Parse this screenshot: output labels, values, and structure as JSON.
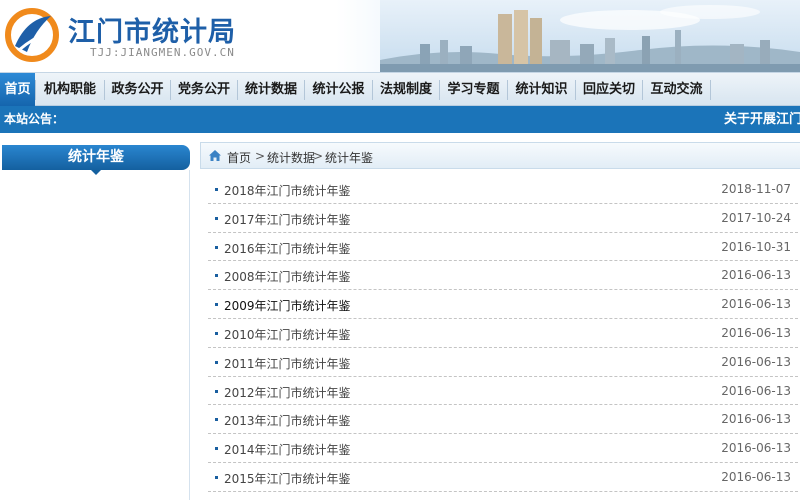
{
  "header": {
    "site_name": "江门市统计局",
    "domain": "TJJ:JIANGMEN.GOV.CN"
  },
  "nav": {
    "items": [
      "首页",
      "机构职能",
      "政务公开",
      "党务公开",
      "统计数据",
      "统计公报",
      "法规制度",
      "学习专题",
      "统计知识",
      "回应关切",
      "互动交流"
    ],
    "active_index": 0
  },
  "notice": {
    "label": "本站公告：",
    "text": "关于开展江门"
  },
  "sidebar": {
    "title": "统计年鉴"
  },
  "breadcrumb": [
    "首页",
    "统计数据",
    "统计年鉴"
  ],
  "breadcrumb_separator": ">",
  "list": [
    {
      "title": "2018年江门市统计年鉴",
      "date": "2018-11-07"
    },
    {
      "title": "2017年江门市统计年鉴",
      "date": "2017-10-24"
    },
    {
      "title": "2016年江门市统计年鉴",
      "date": "2016-10-31"
    },
    {
      "title": "2008年江门市统计年鉴",
      "date": "2016-06-13"
    },
    {
      "title": "2009年江门市统计年鉴",
      "date": "2016-06-13"
    },
    {
      "title": "2010年江门市统计年鉴",
      "date": "2016-06-13"
    },
    {
      "title": "2011年江门市统计年鉴",
      "date": "2016-06-13"
    },
    {
      "title": "2012年江门市统计年鉴",
      "date": "2016-06-13"
    },
    {
      "title": "2013年江门市统计年鉴",
      "date": "2016-06-13"
    },
    {
      "title": "2014年江门市统计年鉴",
      "date": "2016-06-13"
    },
    {
      "title": "2015年江门市统计年鉴",
      "date": "2016-06-13"
    }
  ],
  "colors": {
    "brand_blue": "#1e5fa8",
    "nav_active": "#1565ad",
    "notice_bar": "#1b74b9",
    "logo_orange": "#f08a1c"
  },
  "icons": {
    "logo": "jiangmen-stats-logo-icon",
    "home": "home-icon",
    "bullet": "square-bullet-icon"
  }
}
